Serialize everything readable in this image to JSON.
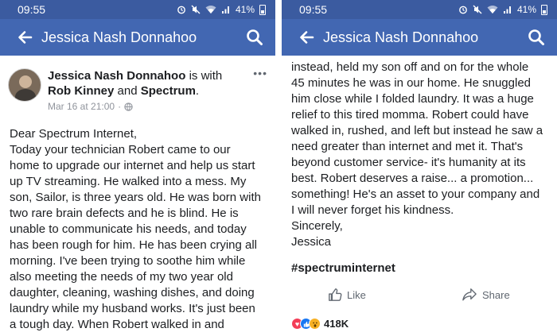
{
  "status": {
    "time": "09:55",
    "battery": "41%"
  },
  "appbar": {
    "title": "Jessica Nash Donnahoo"
  },
  "post": {
    "author": "Jessica Nash Donnahoo",
    "with_word": "is with",
    "tagged_1": "Rob Kinney",
    "and_word": "and",
    "tagged_2": "Spectrum",
    "period": ".",
    "timestamp": "Mar 16 at 21:00",
    "separator": "·",
    "more": "•••"
  },
  "left_lines": [
    "Dear Spectrum Internet,",
    "Today your technician Robert came to our",
    "home to upgrade our internet and help us start",
    "up TV streaming. He walked into a mess. My",
    "son, Sailor, is three years old. He was born with",
    "two rare brain defects and he is blind. He is",
    "unable to communicate his needs, and today",
    "has been rough for him. He has been crying all",
    "morning. I've been trying to soothe him while",
    "also meeting the needs of my two year old",
    "daughter, cleaning, washing dishes, and doing",
    "laundry while my husband works. It's just been",
    "a tough day. When Robert walked in and"
  ],
  "right_lines": [
    "instead, held my son off and on for the whole",
    "45 minutes he was in our home. He snuggled",
    "him close while I folded laundry. It was a huge",
    "relief to this tired momma. Robert could have",
    "walked in, rushed, and left but instead he saw a",
    "need greater than internet and met it. That's",
    "beyond customer service- it's humanity at its",
    "best. Robert deserves a raise... a promotion...",
    "something! He's an asset to your company and",
    "I will never forget his kindness.",
    "Sincerely,",
    "Jessica"
  ],
  "hashtag": "#spectruminternet",
  "actions": {
    "like": "Like",
    "share": "Share"
  },
  "reactions": {
    "count": "418K",
    "types": [
      "love",
      "like",
      "wow"
    ]
  },
  "icons": [
    "back-arrow-icon",
    "search-icon",
    "alarm-icon",
    "mute-icon",
    "wifi-icon",
    "signal-icon",
    "battery-icon",
    "globe-icon",
    "thumbs-up-icon",
    "share-arrow-icon"
  ],
  "colors": {
    "appbar": "#4267b2",
    "statusbar": "#3b5ba0",
    "text": "#1c1e21",
    "meta": "#90949c"
  }
}
